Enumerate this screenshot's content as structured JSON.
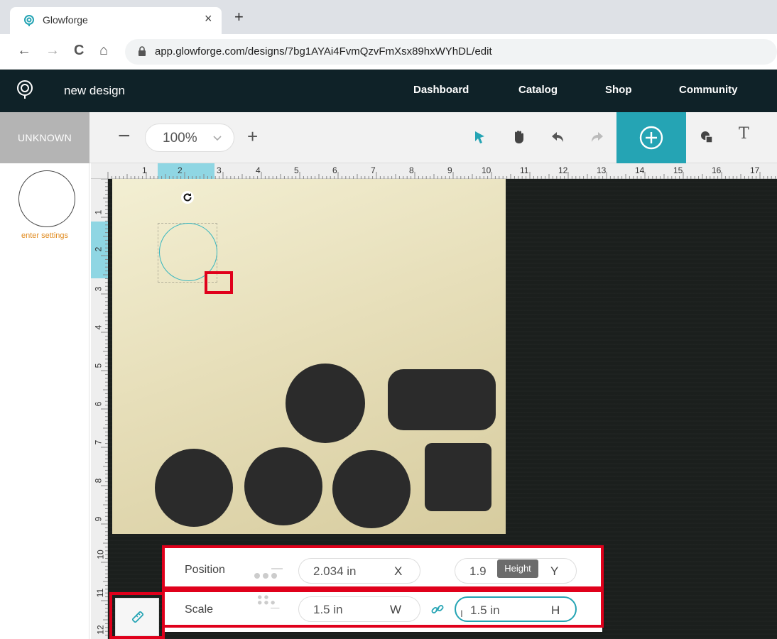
{
  "browser": {
    "tab_title": "Glowforge",
    "tab_close": "×",
    "new_tab": "+",
    "url": "app.glowforge.com/designs/7bg1AYAi4FvmQzvFmXsx89hxWYhDL/edit",
    "nav": {
      "back": "←",
      "forward": "→",
      "reload": "C",
      "home": "⌂"
    }
  },
  "header": {
    "design_title": "new design",
    "nav": [
      "Dashboard",
      "Catalog",
      "Shop",
      "Community"
    ]
  },
  "toolbar": {
    "material": "UNKNOWN",
    "zoom_out": "−",
    "zoom": "100%",
    "zoom_in": "+",
    "text_tool": "T",
    "tools": [
      "select-arrow-icon",
      "hand-icon",
      "undo-icon",
      "redo-icon",
      "add-circle-icon",
      "shapes-icon",
      "text-icon"
    ]
  },
  "thumbnails": {
    "settings_label": "enter settings"
  },
  "rulers": {
    "top": [
      "1",
      "2",
      "3",
      "4",
      "5",
      "6",
      "7",
      "8",
      "9",
      "10",
      "11",
      "12",
      "13",
      "14",
      "15",
      "16",
      "17"
    ],
    "left": [
      "1",
      "2",
      "3",
      "4",
      "5",
      "6",
      "7",
      "8",
      "9",
      "10",
      "11",
      "12"
    ]
  },
  "panel": {
    "position_label": "Position",
    "x_value": "2.034 in",
    "x_axis": "X",
    "y_value": "1.9",
    "y_axis": "Y",
    "tooltip": "Height",
    "scale_label": "Scale",
    "w_value": "1.5 in",
    "w_axis": "W",
    "h_value": "1.5 in",
    "h_axis": "H"
  },
  "colors": {
    "accent": "#25a4b4",
    "header_bg": "#0f2228",
    "marker": "#e0001b",
    "settings_text": "#e08a1e"
  }
}
